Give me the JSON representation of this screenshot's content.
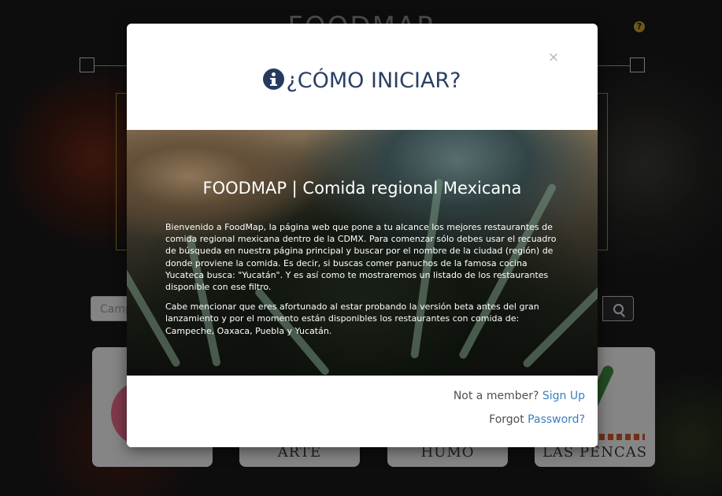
{
  "background": {
    "logo": "FOODMAP",
    "help_icon": "question-icon",
    "search_placeholder": "Camp",
    "search_icon": "search-icon",
    "cards": [
      {
        "label": ""
      },
      {
        "label": "ARTE"
      },
      {
        "label": "HUMO"
      },
      {
        "label": "LAS PENCAS"
      }
    ]
  },
  "modal": {
    "close_label": "×",
    "title": "¿CÓMO INICIAR?",
    "title_icon": "info-icon",
    "hero_title": "FOODMAP | Comida regional Mexicana",
    "paragraphs": [
      "Bienvenido a FoodMap, la página web que pone a tu alcance los mejores restaurantes de comida regional mexicana dentro de la CDMX. Para comenzar sólo debes usar el recuadro de búsqueda en nuestra página principal y buscar por el nombre de la ciudad (región) de donde proviene la comida. Es decir, si buscas comer panuchos de la famosa cocina Yucateca busca: \"Yucatán\". Y es así como te mostraremos un listado de los restaurantes disponible con ese filtro.",
      "Cabe mencionar que eres afortunado al estar probando la versión beta antes del gran lanzamiento y por el momento están disponibles los restaurantes con comida de: Campeche, Oaxaca, Puebla y Yucatán."
    ],
    "footer": {
      "member_text": "Not a member?",
      "signup_link": "Sign Up",
      "forgot_text": "Forgot",
      "password_link": "Password?"
    }
  },
  "colors": {
    "title": "#2a3f66",
    "link": "#3c7ebf",
    "accent_gold": "#caa12a"
  }
}
